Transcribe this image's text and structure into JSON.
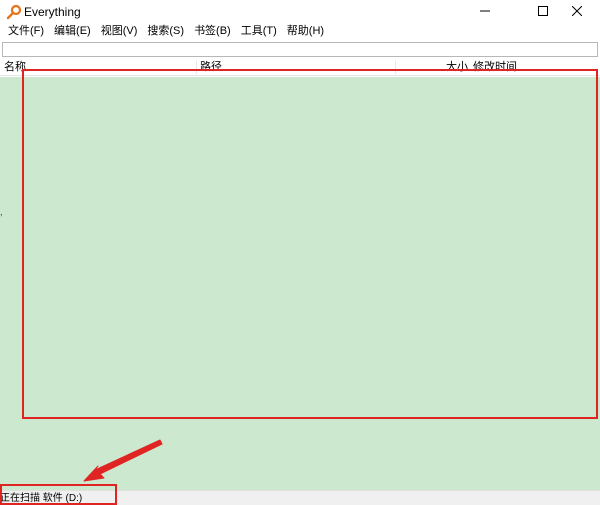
{
  "window": {
    "title": "Everything",
    "controls": {
      "minimize": "minimize",
      "maximize": "maximize",
      "close": "close"
    }
  },
  "menu": [
    {
      "label": "文件(F)"
    },
    {
      "label": "编辑(E)"
    },
    {
      "label": "视图(V)"
    },
    {
      "label": "搜索(S)"
    },
    {
      "label": "书签(B)"
    },
    {
      "label": "工具(T)"
    },
    {
      "label": "帮助(H)"
    }
  ],
  "search": {
    "value": "",
    "placeholder": ""
  },
  "columns": {
    "name": "名称",
    "path": "路径",
    "size": "大小",
    "modified": "修改时间"
  },
  "results": {
    "edge_mark": ","
  },
  "status": {
    "text": "正在扫描 软件 (D:)"
  },
  "colors": {
    "results_bg": "#cce8cf",
    "annotation_red": "#e02424",
    "icon_orange": "#e8731a"
  },
  "icons": {
    "app": "search-key-icon",
    "minimize": "minimize-icon",
    "maximize": "maximize-icon",
    "close": "close-icon"
  }
}
